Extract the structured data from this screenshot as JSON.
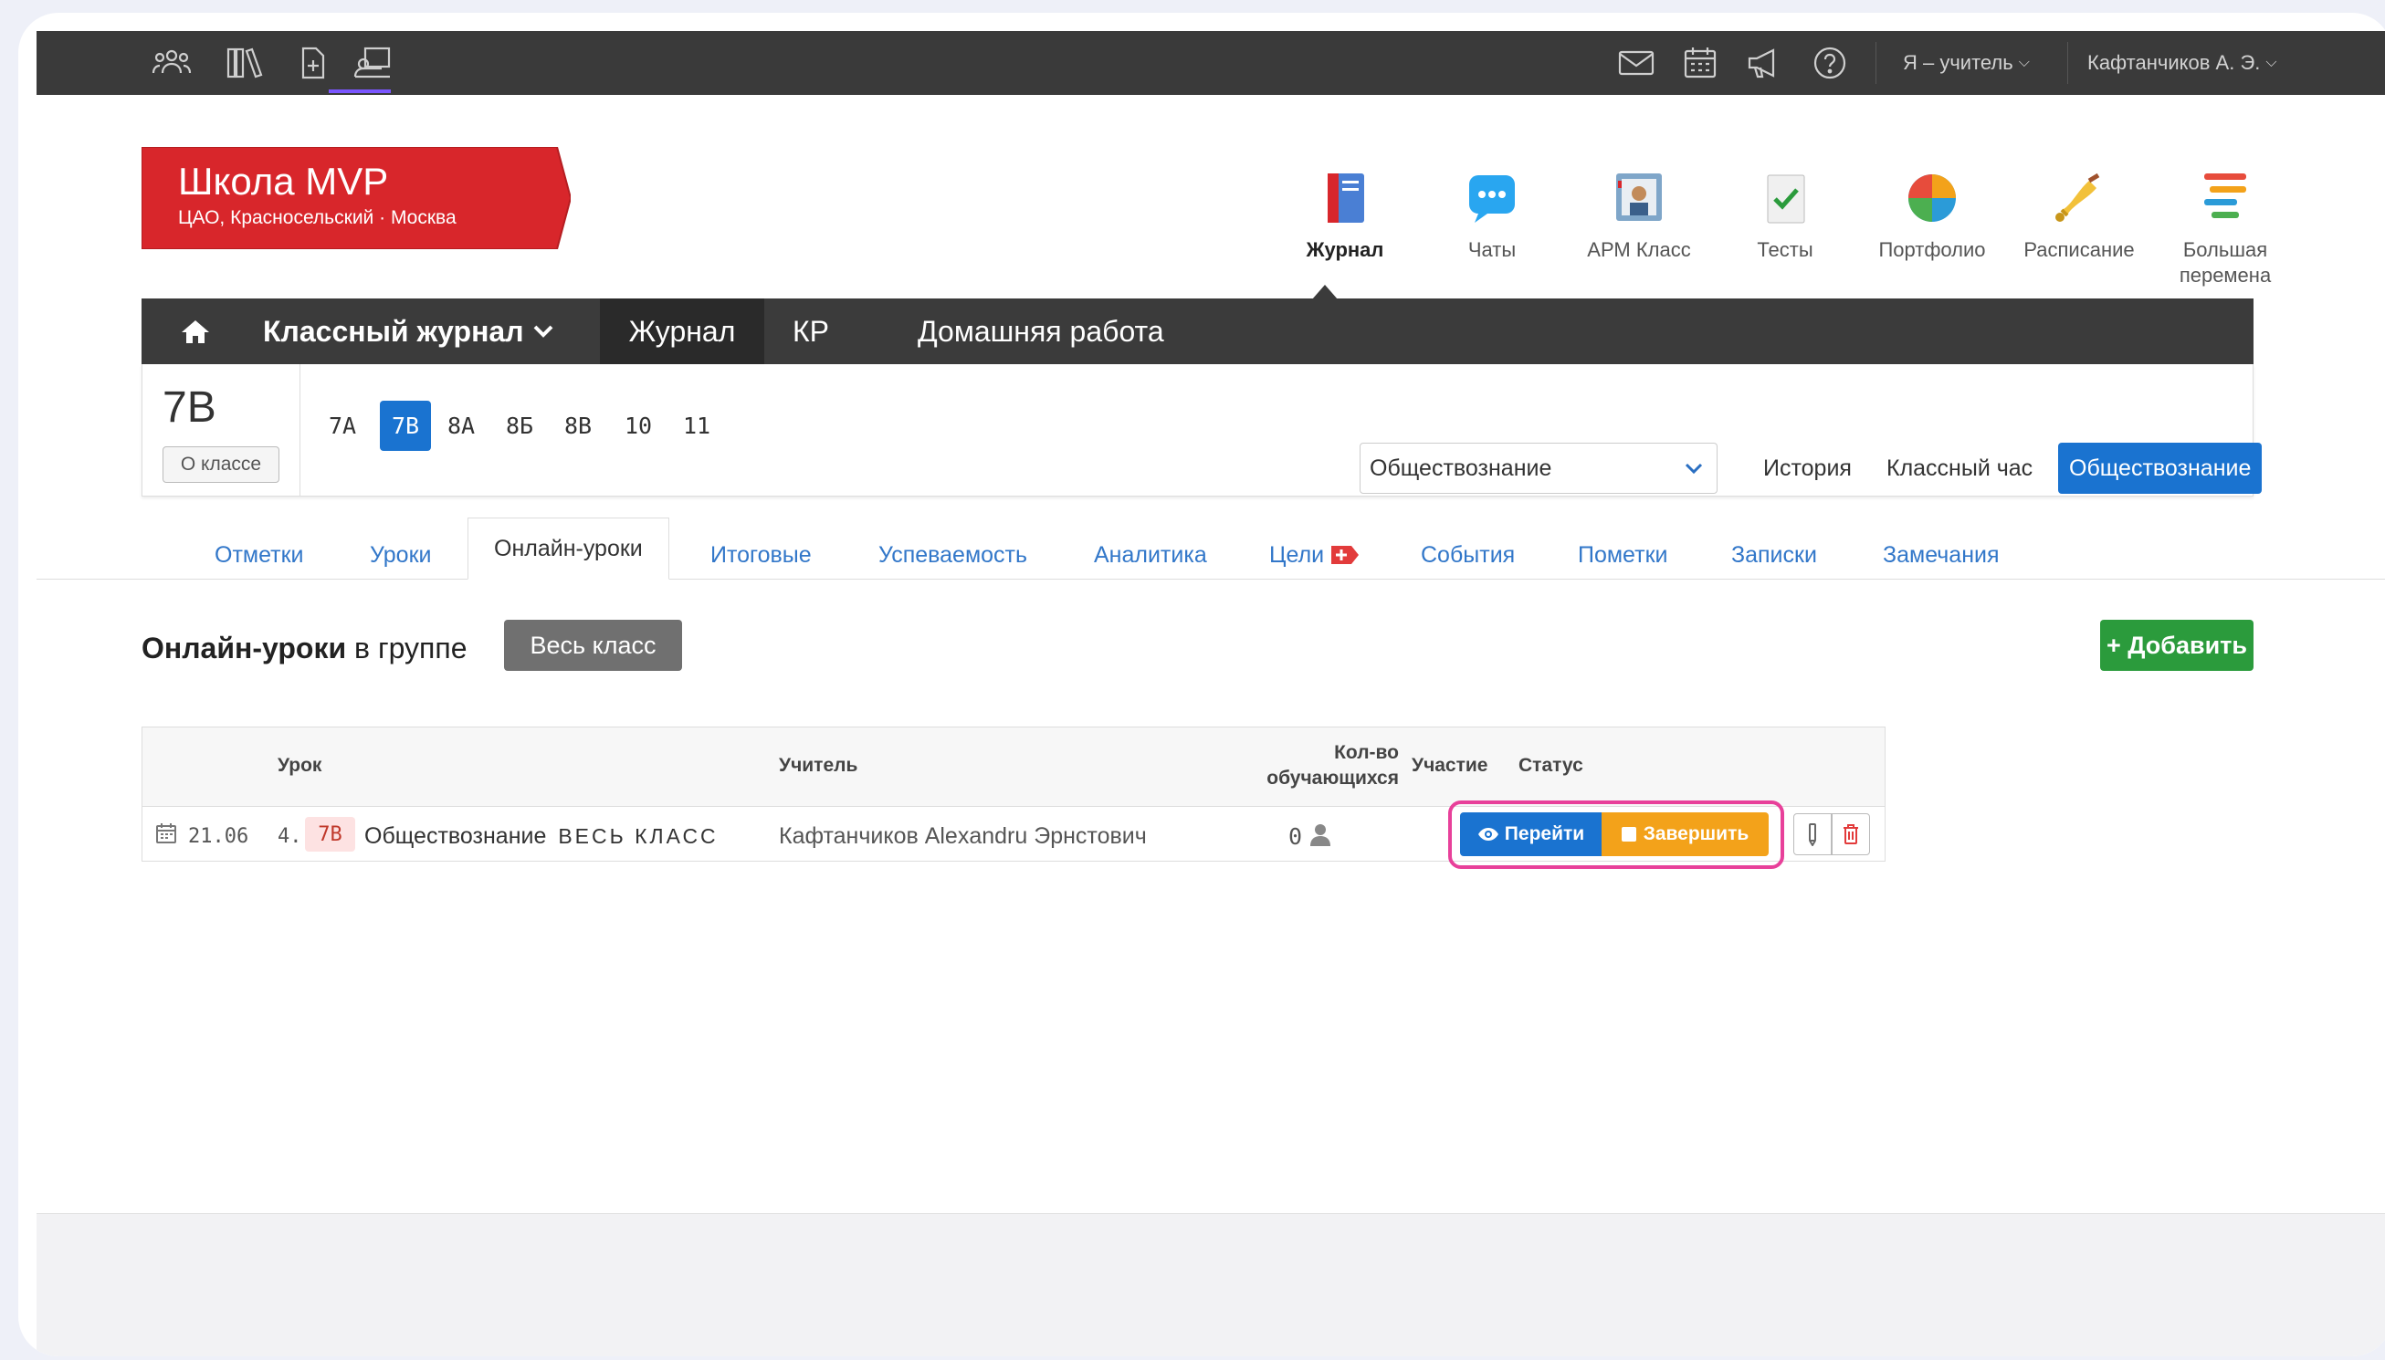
{
  "topbar": {
    "role_label": "Я – учитель",
    "user_name": "Кафтанчиков А. Э."
  },
  "school": {
    "name": "Школа MVP",
    "location": "ЦАО, Красносельский · Москва"
  },
  "apps": [
    {
      "label": "Журнал",
      "icon": "journal-icon"
    },
    {
      "label": "Чаты",
      "icon": "chat-icon"
    },
    {
      "label": "АРМ Класс",
      "icon": "classroom-icon"
    },
    {
      "label": "Тесты",
      "icon": "tests-icon"
    },
    {
      "label": "Портфолио",
      "icon": "portfolio-icon"
    },
    {
      "label": "Расписание",
      "icon": "bell-icon"
    },
    {
      "label": "Большая перемена",
      "icon": "big-break-icon"
    }
  ],
  "nav": {
    "journal_dropdown": "Классный журнал",
    "journal": "Журнал",
    "kr": "КР",
    "homework": "Домашняя работа"
  },
  "classbar": {
    "current_class": "7В",
    "about_label": "О классе",
    "classes": [
      "7А",
      "7В",
      "8А",
      "8Б",
      "8В",
      "10",
      "11"
    ],
    "selected_class": "7В",
    "subject_select_value": "Обществознание",
    "subjects": [
      "История",
      "Классный час",
      "Обществознание"
    ],
    "selected_subject": "Обществознание"
  },
  "tabs": [
    "Отметки",
    "Уроки",
    "Онлайн-уроки",
    "Итоговые",
    "Успеваемость",
    "Аналитика",
    "Цели",
    "События",
    "Пометки",
    "Записки",
    "Замечания"
  ],
  "active_tab": "Онлайн-уроки",
  "content": {
    "title_bold": "Онлайн-уроки",
    "title_rest": " в группе",
    "group_label": "Весь класс",
    "add_label": "+ Добавить"
  },
  "table": {
    "headers": {
      "lesson": "Урок",
      "teacher": "Учитель",
      "count_line1": "Кол-во",
      "count_line2": "обучающихся",
      "participation": "Участие",
      "status": "Статус"
    },
    "rows": [
      {
        "date": "21.06",
        "number": "4.",
        "class_tag": "7В",
        "subject": "Обществознание",
        "group": "ВЕСЬ КЛАСС",
        "teacher": "Кафтанчиков Alexandru Эрнстович",
        "count": "0",
        "go_label": "Перейти",
        "finish_label": "Завершить"
      }
    ]
  },
  "colors": {
    "topbar": "#3a3a3a",
    "brand_red": "#d8262b",
    "primary_blue": "#1a73d0",
    "success_green": "#2b9b3c",
    "warning_orange": "#f3a21a",
    "highlight_pink": "#e8409a"
  }
}
